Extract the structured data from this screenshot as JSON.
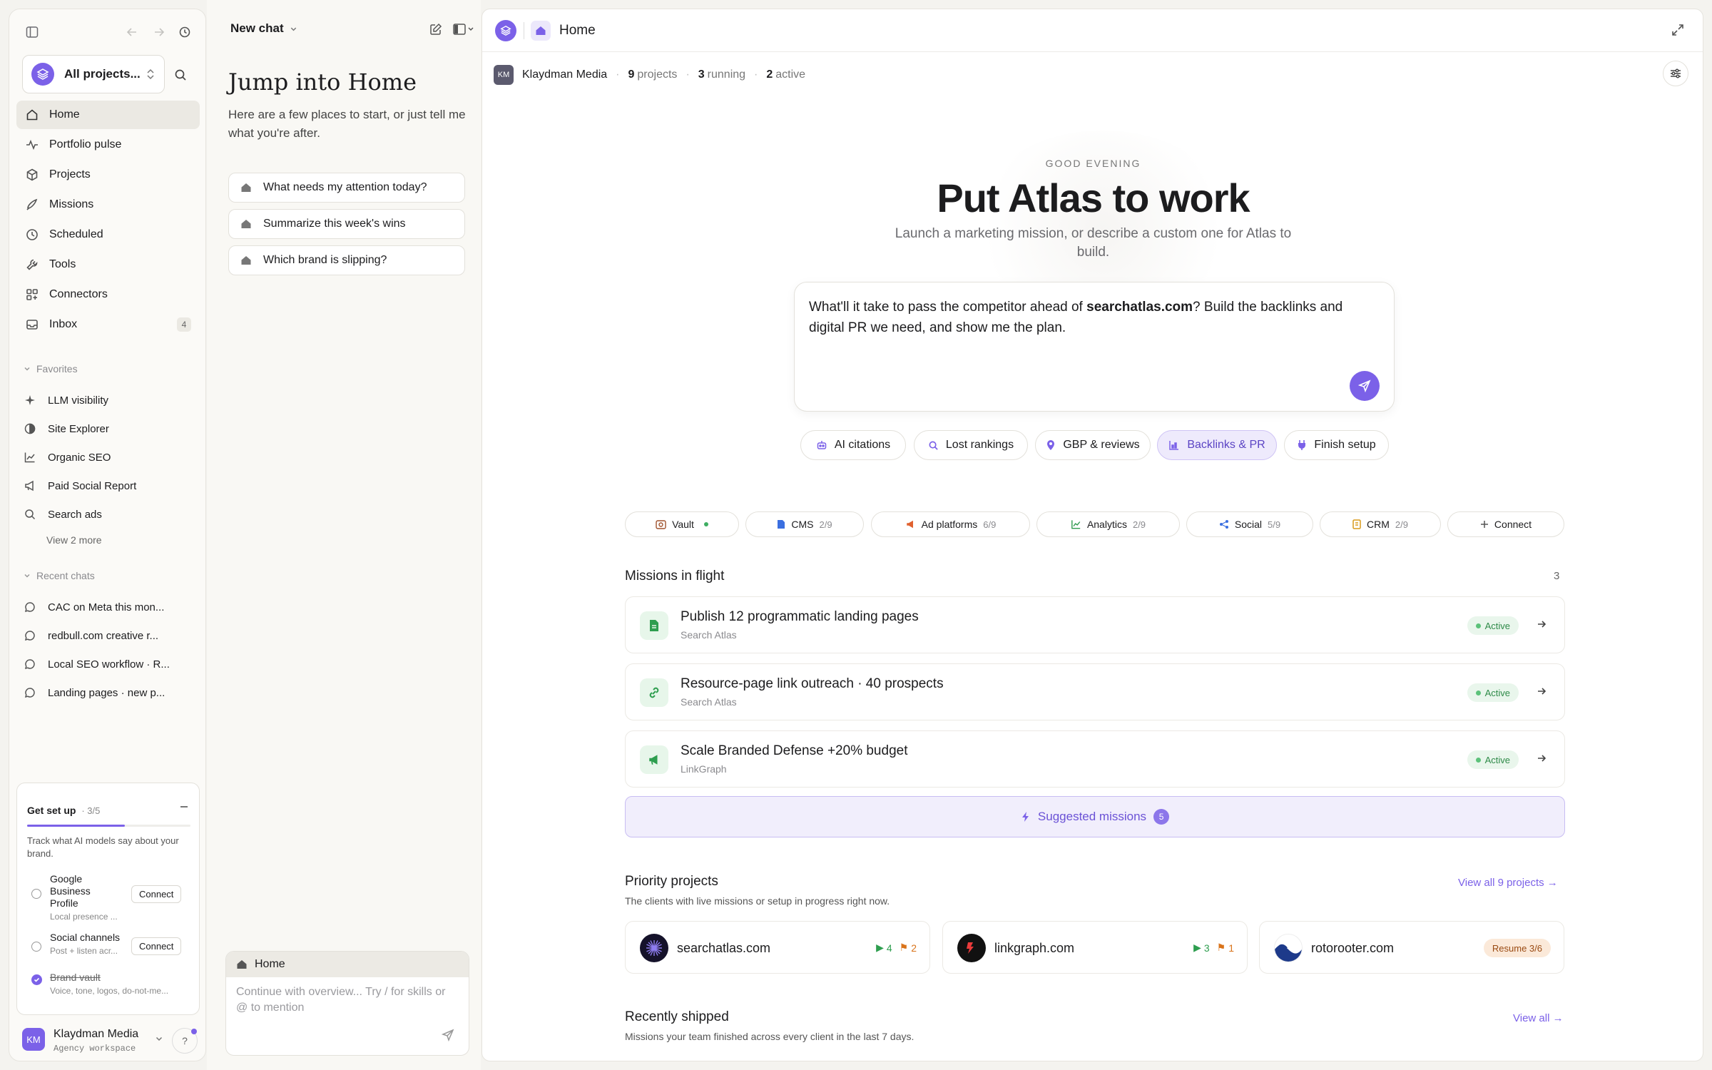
{
  "sidebar": {
    "workspace_selector": "All projects...",
    "nav": [
      {
        "label": "Home",
        "icon": "home-icon"
      },
      {
        "label": "Portfolio pulse",
        "icon": "pulse-icon"
      },
      {
        "label": "Projects",
        "icon": "cube-icon"
      },
      {
        "label": "Missions",
        "icon": "rocket-icon"
      },
      {
        "label": "Scheduled",
        "icon": "clock-icon"
      },
      {
        "label": "Tools",
        "icon": "wrench-icon"
      },
      {
        "label": "Connectors",
        "icon": "grid-plus-icon"
      },
      {
        "label": "Inbox",
        "icon": "inbox-icon",
        "badge": "4"
      }
    ],
    "favorites_header": "Favorites",
    "favorites": [
      {
        "label": "LLM visibility",
        "icon": "sparkle-icon"
      },
      {
        "label": "Site Explorer",
        "icon": "half-circle-icon"
      },
      {
        "label": "Organic SEO",
        "icon": "chart-line-icon"
      },
      {
        "label": "Paid Social Report",
        "icon": "megaphone-icon"
      },
      {
        "label": "Search ads",
        "icon": "search-icon"
      }
    ],
    "view_more": "View 2 more",
    "recent_header": "Recent chats",
    "recent": [
      {
        "label": "CAC on Meta this mon..."
      },
      {
        "label": "redbull.com creative r..."
      },
      {
        "label": "Local SEO workflow · R..."
      },
      {
        "label": "Landing pages · new p..."
      }
    ],
    "setup": {
      "title": "Get set up",
      "progress": "· 3/5",
      "progress_fraction": 0.6,
      "desc": "Track what AI models say about your brand.",
      "items": [
        {
          "name": "Google Business Profile",
          "sub": "Local presence ...",
          "action": "Connect"
        },
        {
          "name": "Social channels",
          "sub": "Post + listen acr...",
          "action": "Connect"
        },
        {
          "name": "Brand vault",
          "sub": "Voice, tone, logos, do-not-me...",
          "done": true
        }
      ]
    },
    "account": {
      "initials": "KM",
      "name": "Klaydman Media",
      "type": "Agency workspace",
      "help": "?"
    }
  },
  "chat": {
    "title": "New chat",
    "heading": "Jump into Home",
    "subheading": "Here are a few places to start, or just tell me what you're after.",
    "suggestions": [
      "What needs my attention today?",
      "Summarize this week's wins",
      "Which brand is slipping?"
    ],
    "context_label": "Home",
    "input_placeholder": "Continue with overview...  Try / for skills or @ to mention"
  },
  "main": {
    "title": "Home",
    "client": {
      "initials": "KM",
      "name": "Klaydman Media"
    },
    "stats": [
      {
        "num": "9",
        "label": "projects"
      },
      {
        "num": "3",
        "label": "running"
      },
      {
        "num": "2",
        "label": "active"
      }
    ],
    "greeting": "GOOD EVENING",
    "hero_title": "Put Atlas to work",
    "hero_sub": "Launch a marketing mission, or describe a custom one for Atlas to build.",
    "prompt": {
      "before": "What'll it take to pass the competitor ahead of ",
      "domain": "searchatlas.com",
      "after": "? Build the backlinks and digital PR we need, and show me the plan."
    },
    "chips": [
      {
        "label": "AI citations",
        "icon": "robot-icon"
      },
      {
        "label": "Lost rankings",
        "icon": "search-icon"
      },
      {
        "label": "GBP & reviews",
        "icon": "pin-icon"
      },
      {
        "label": "Backlinks & PR",
        "icon": "chart-bar-icon",
        "active": true
      },
      {
        "label": "Finish setup",
        "icon": "plug-icon"
      }
    ],
    "connectors": [
      {
        "label": "Vault",
        "count": ""
      },
      {
        "label": "CMS",
        "count": "2/9"
      },
      {
        "label": "Ad platforms",
        "count": "6/9"
      },
      {
        "label": "Analytics",
        "count": "2/9"
      },
      {
        "label": "Social",
        "count": "5/9"
      },
      {
        "label": "CRM",
        "count": "2/9"
      },
      {
        "label": "Connect",
        "count": ""
      }
    ],
    "missions_title": "Missions in flight",
    "missions_count": "3",
    "missions": [
      {
        "title": "Publish 12 programmatic landing pages",
        "sub": "Search Atlas",
        "status": "Active",
        "icon": "document-icon"
      },
      {
        "title": "Resource-page link outreach · 40 prospects",
        "sub": "Search Atlas",
        "status": "Active",
        "icon": "link-icon"
      },
      {
        "title": "Scale Branded Defense +20% budget",
        "sub": "LinkGraph",
        "status": "Active",
        "icon": "megaphone-icon"
      }
    ],
    "suggested": {
      "label": "Suggested missions",
      "count": "5"
    },
    "priority": {
      "title": "Priority projects",
      "sub": "The clients with live missions or setup in progress right now.",
      "view_all": "View all 9 projects →",
      "projects": [
        {
          "name": "searchatlas.com",
          "a": "4",
          "b": "2"
        },
        {
          "name": "linkgraph.com",
          "a": "3",
          "b": "1"
        },
        {
          "name": "rotorooter.com",
          "resume": "Resume 3/6"
        }
      ]
    },
    "recent": {
      "title": "Recently shipped",
      "sub": "Missions your team finished across every client in the last 7 days.",
      "view_all": "View all →"
    }
  },
  "colors": {
    "accent": "#7b61e8",
    "active_green": "#2e8a48",
    "bg": "#f4f3ef"
  }
}
